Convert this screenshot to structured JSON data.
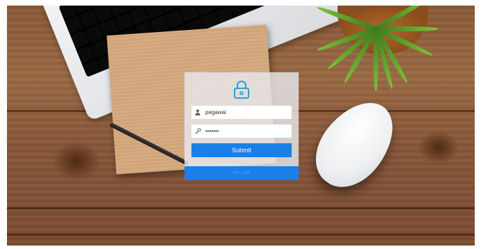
{
  "login": {
    "username_value": "pegawai",
    "password_value": "•••••••",
    "submit_label": "Submit",
    "footer_link_label": "Pen-ndik"
  },
  "icons": {
    "lock": "lock-icon",
    "user": "user-icon",
    "key": "key-icon"
  },
  "colors": {
    "accent": "#1a7fe8",
    "lock_icon": "#2e9fd6",
    "panel": "#e6e8ec"
  }
}
